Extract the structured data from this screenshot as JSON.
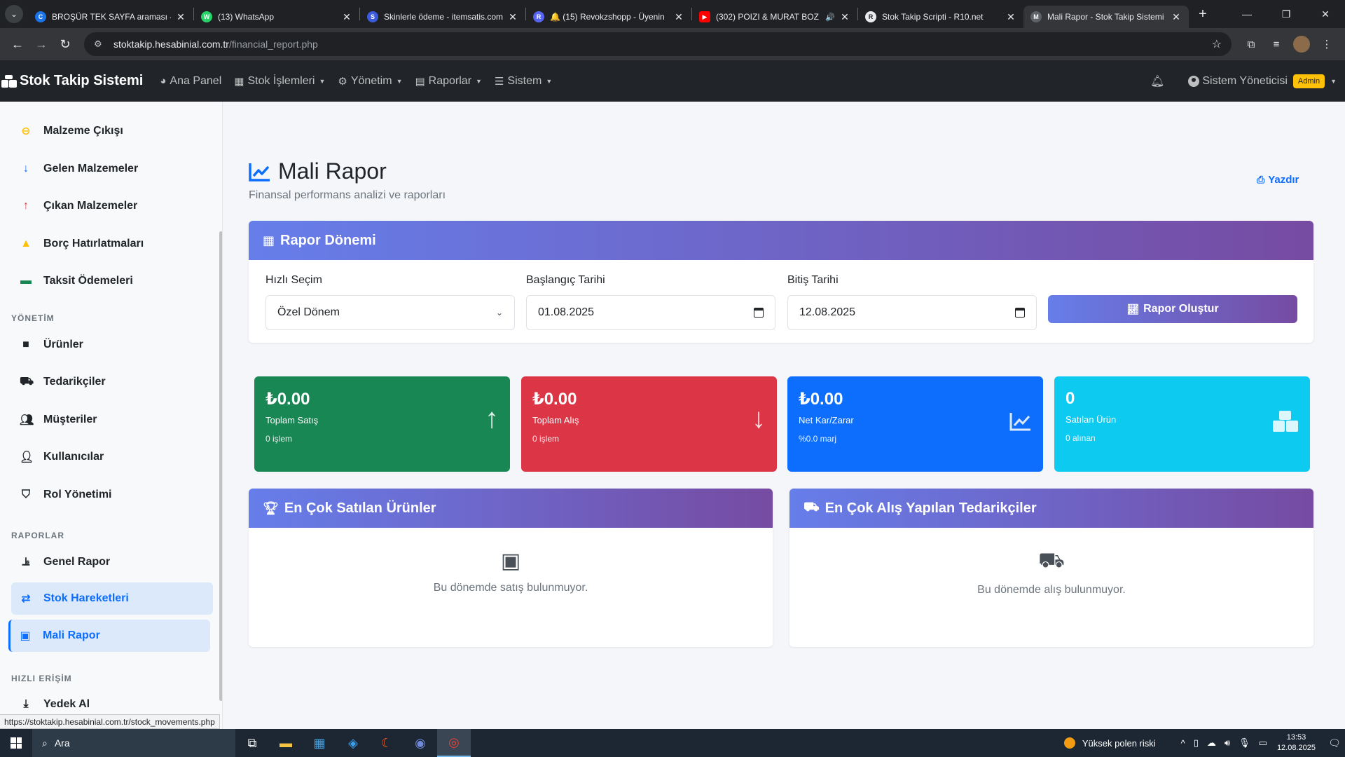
{
  "browser": {
    "tabs": [
      {
        "title": "BROŞÜR TEK SAYFA araması - C",
        "fav_color": "#1a73e8",
        "fav_glyph": "C"
      },
      {
        "title": "(13) WhatsApp",
        "fav_color": "#25d366",
        "fav_glyph": "W"
      },
      {
        "title": "Skinlerle ödeme - itemsatis.com",
        "fav_color": "#3b5bdb",
        "fav_glyph": "S"
      },
      {
        "title": "🔔 (15) Revokzshopp - Üyenin",
        "fav_color": "#5865f2",
        "fav_glyph": "R"
      },
      {
        "title": "(302) POIZI & MURAT BOZ",
        "fav_color": "#ff0000",
        "fav_glyph": "▶"
      },
      {
        "title": "Stok Takip Scripti - R10.net",
        "fav_color": "#e8eaed",
        "fav_glyph": "R"
      },
      {
        "title": "Mali Rapor - Stok Takip Sistemi",
        "fav_color": "#5f6368",
        "fav_glyph": "M"
      }
    ],
    "url_host": "stoktakip.hesabinial.com.tr",
    "url_path": "/financial_report.php",
    "status_url": "https://stoktakip.hesabinial.com.tr/stock_movements.php"
  },
  "navbar": {
    "brand": "Stok Takip Sistemi",
    "items": [
      {
        "label": "Ana Panel",
        "has_caret": false
      },
      {
        "label": "Stok İşlemleri",
        "has_caret": true
      },
      {
        "label": "Yönetim",
        "has_caret": true
      },
      {
        "label": "Raporlar",
        "has_caret": true
      },
      {
        "label": "Sistem",
        "has_caret": true
      }
    ],
    "user_name": "Sistem Yöneticisi",
    "user_badge": "Admin"
  },
  "sidebar": {
    "items_top": [
      "Malzeme Çıkışı",
      "Gelen Malzemeler",
      "Çıkan Malzemeler",
      "Borç Hatırlatmaları",
      "Taksit Ödemeleri"
    ],
    "section_management": "YÖNETİM",
    "items_management": [
      "Ürünler",
      "Tedarikçiler",
      "Müşteriler",
      "Kullanıcılar",
      "Rol Yönetimi"
    ],
    "section_reports": "RAPORLAR",
    "items_reports": [
      "Genel Rapor",
      "Stok Hareketleri",
      "Mali Rapor"
    ],
    "section_quick": "HIZLI ERİŞİM",
    "items_quick": [
      "Yedek Al"
    ]
  },
  "page": {
    "title": "Mali Rapor",
    "subtitle": "Finansal performans analizi ve raporları",
    "print_label": "Yazdır"
  },
  "period": {
    "header": "Rapor Dönemi",
    "quick_label": "Hızlı Seçim",
    "quick_value": "Özel Dönem",
    "start_label": "Başlangıç Tarihi",
    "start_value": "01.08.2025",
    "end_label": "Bitiş Tarihi",
    "end_value": "12.08.2025",
    "button": "Rapor Oluştur"
  },
  "stats": [
    {
      "value": "₺0.00",
      "label": "Toplam Satış",
      "sub": "0 işlem",
      "color": "#198754"
    },
    {
      "value": "₺0.00",
      "label": "Toplam Alış",
      "sub": "0 işlem",
      "color": "#dc3545"
    },
    {
      "value": "₺0.00",
      "label": "Net Kar/Zarar",
      "sub": "%0.0 marj",
      "color": "#0d6efd"
    },
    {
      "value": "0",
      "label": "Satılan Ürün",
      "sub": "0 alınan",
      "color": "#0dcaf0"
    }
  ],
  "top_products": {
    "header": "En Çok Satılan Ürünler",
    "empty": "Bu dönemde satış bulunmuyor."
  },
  "top_suppliers": {
    "header": "En Çok Alış Yapılan Tedarikçiler",
    "empty": "Bu dönemde alış bulunmuyor."
  },
  "taskbar": {
    "search": "Ara",
    "weather": "Yüksek polen riski",
    "time": "13:53",
    "date": "12.08.2025"
  }
}
